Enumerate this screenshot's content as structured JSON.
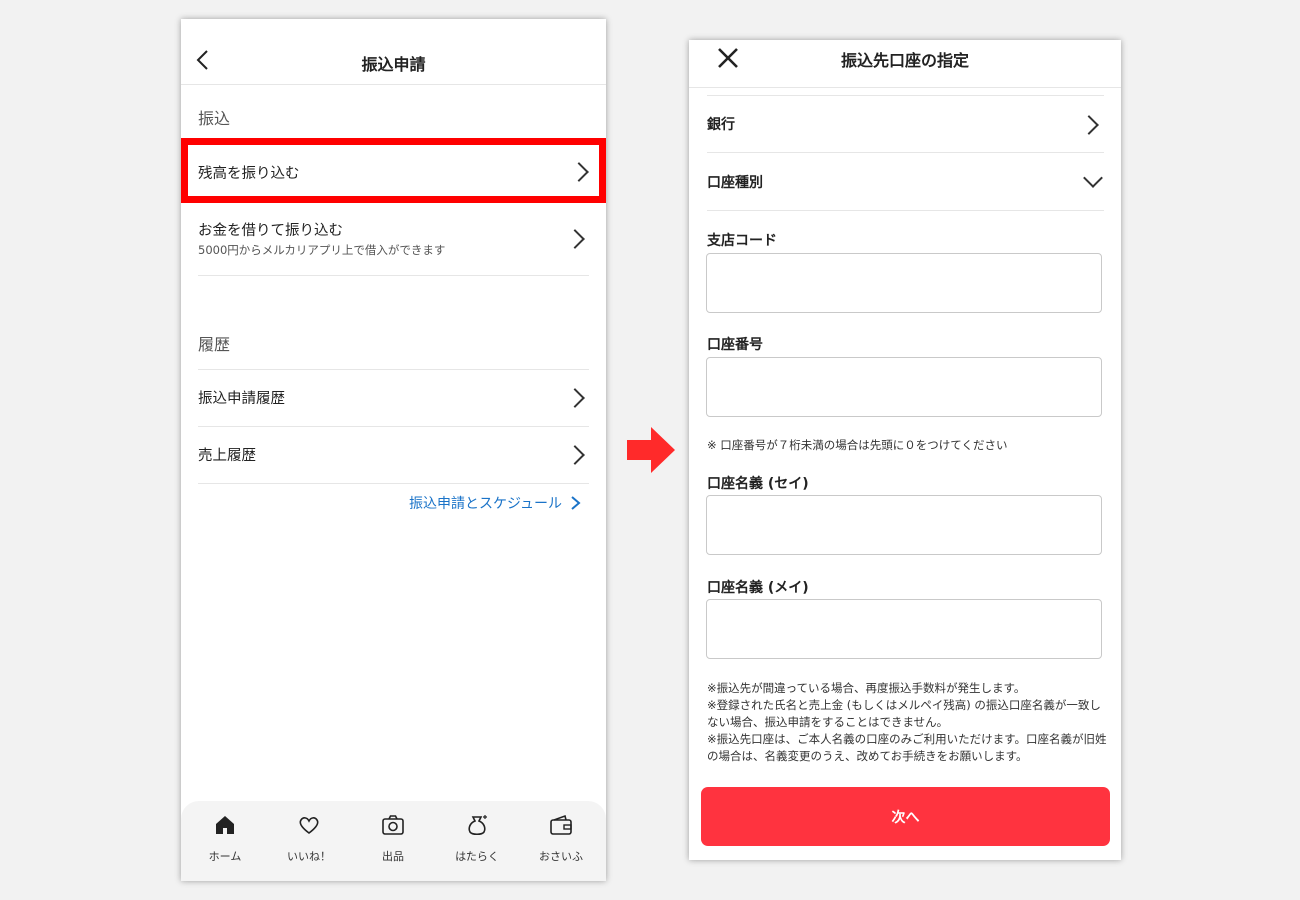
{
  "left": {
    "header": {
      "title": "振込申請"
    },
    "section_transfer": "振込",
    "rows": [
      {
        "label": "残高を振り込む"
      },
      {
        "label": "お金を借りて振り込む",
        "sub": "5000円からメルカリアプリ上で借入ができます"
      }
    ],
    "section_history": "履歴",
    "history_rows": [
      {
        "label": "振込申請履歴"
      },
      {
        "label": "売上履歴"
      }
    ],
    "schedule_link": "振込申請とスケジュール",
    "tabs": [
      {
        "label": "ホーム",
        "icon": "home-icon"
      },
      {
        "label": "いいね！",
        "icon": "heart-icon"
      },
      {
        "label": "出品",
        "icon": "camera-icon"
      },
      {
        "label": "はたらく",
        "icon": "bag-icon"
      },
      {
        "label": "おさいふ",
        "icon": "wallet-icon"
      }
    ],
    "highlight_color": "#ff0000",
    "link_color": "#1a73c8"
  },
  "right": {
    "header": {
      "title": "振込先口座の指定"
    },
    "bank_label": "銀行",
    "account_type_label": "口座種別",
    "branch_code_label": "支店コード",
    "branch_code_value": "",
    "account_number_label": "口座番号",
    "account_number_value": "",
    "account_number_note": "※ 口座番号が７桁未満の場合は先頭に０をつけてください",
    "name_sei_label": "口座名義 (セイ)",
    "name_sei_value": "",
    "name_mei_label": "口座名義 (メイ)",
    "name_mei_value": "",
    "notes": [
      "※振込先が間違っている場合、再度振込手数料が発生します。",
      "※登録された氏名と売上金 (もしくはメルペイ残高) の振込口座名義が一致しない場合、振込申請をすることはできません。",
      "※振込先口座は、ご本人名義の口座のみご利用いただけます。口座名義が旧姓の場合は、名義変更のうえ、改めてお手続きをお願いします。"
    ],
    "next_button": "次へ",
    "button_color": "#ff333f"
  }
}
